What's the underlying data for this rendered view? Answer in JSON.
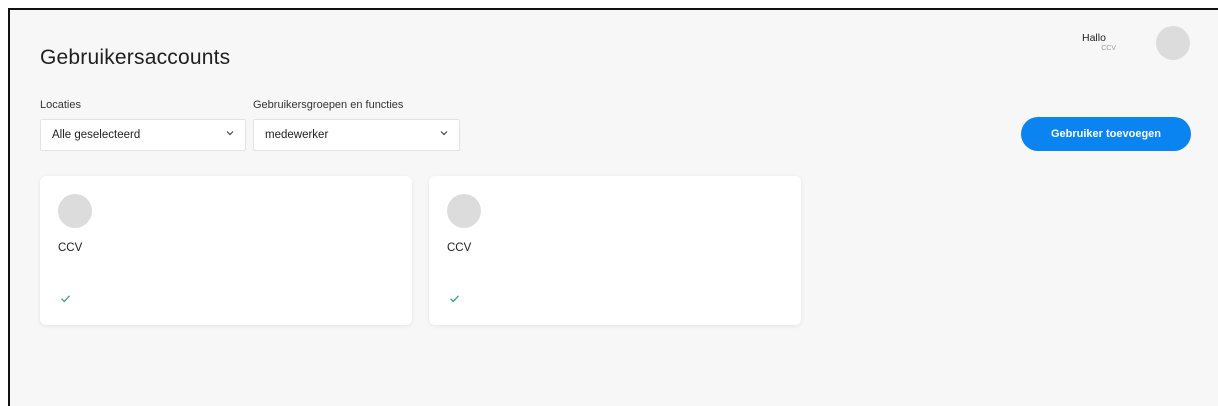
{
  "header": {
    "title": "Gebruikersaccounts",
    "greeting": "Hallo",
    "user_sub": "CCV",
    "avatar_icon": "user-avatar-placeholder"
  },
  "filters": {
    "locations": {
      "label": "Locaties",
      "value": "Alle geselecteerd"
    },
    "groups": {
      "label": "Gebruikersgroepen en functies",
      "value": "medewerker"
    }
  },
  "actions": {
    "add_user_label": "Gebruiker toevoegen"
  },
  "users": [
    {
      "name": "CCV",
      "status_icon": "check-icon"
    },
    {
      "name": "CCV",
      "status_icon": "check-icon"
    }
  ],
  "colors": {
    "accent": "#0a84f0",
    "check": "#2aa876",
    "page_bg": "#f7f7f8",
    "avatar": "#dcdcdc"
  }
}
